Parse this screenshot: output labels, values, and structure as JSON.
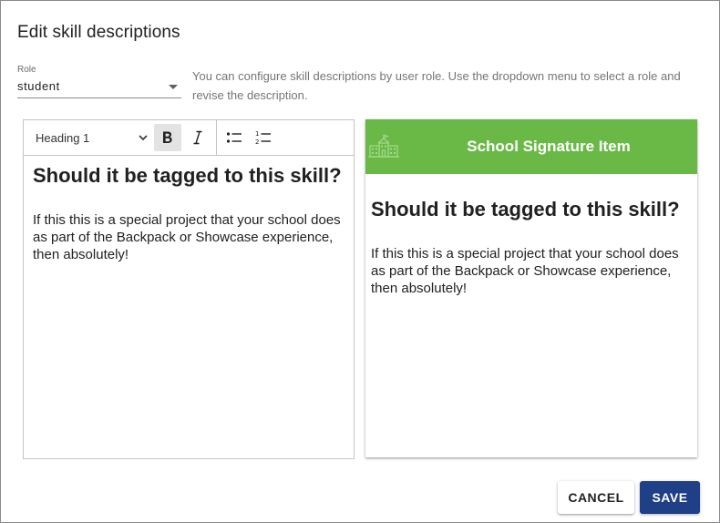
{
  "dialog": {
    "title": "Edit skill descriptions"
  },
  "role": {
    "label": "Role",
    "value": "student",
    "help": "You can configure skill descriptions by user role. Use the dropdown menu to select a role and revise the description."
  },
  "editor": {
    "toolbar": {
      "block_format": "Heading 1",
      "bold_icon": "bold-icon",
      "italic_icon": "italic-icon",
      "bullet_list_icon": "bulleted-list-icon",
      "numbered_list_icon": "numbered-list-icon",
      "bold_active": true
    },
    "content": {
      "heading": "Should it be tagged to this skill?",
      "paragraph": "If this this is a special project that your school does as part of the Backpack or Showcase experience, then absolutely!"
    }
  },
  "preview": {
    "header_title": "School Signature Item",
    "header_icon": "school-building-icon",
    "header_color": "#6ab947",
    "heading": "Should it be tagged to this skill?",
    "paragraph": "If this this is a special project that your school does as part of the Backpack or Showcase experience, then absolutely!"
  },
  "actions": {
    "cancel_label": "CANCEL",
    "save_label": "SAVE",
    "save_color": "#1f3f86"
  }
}
